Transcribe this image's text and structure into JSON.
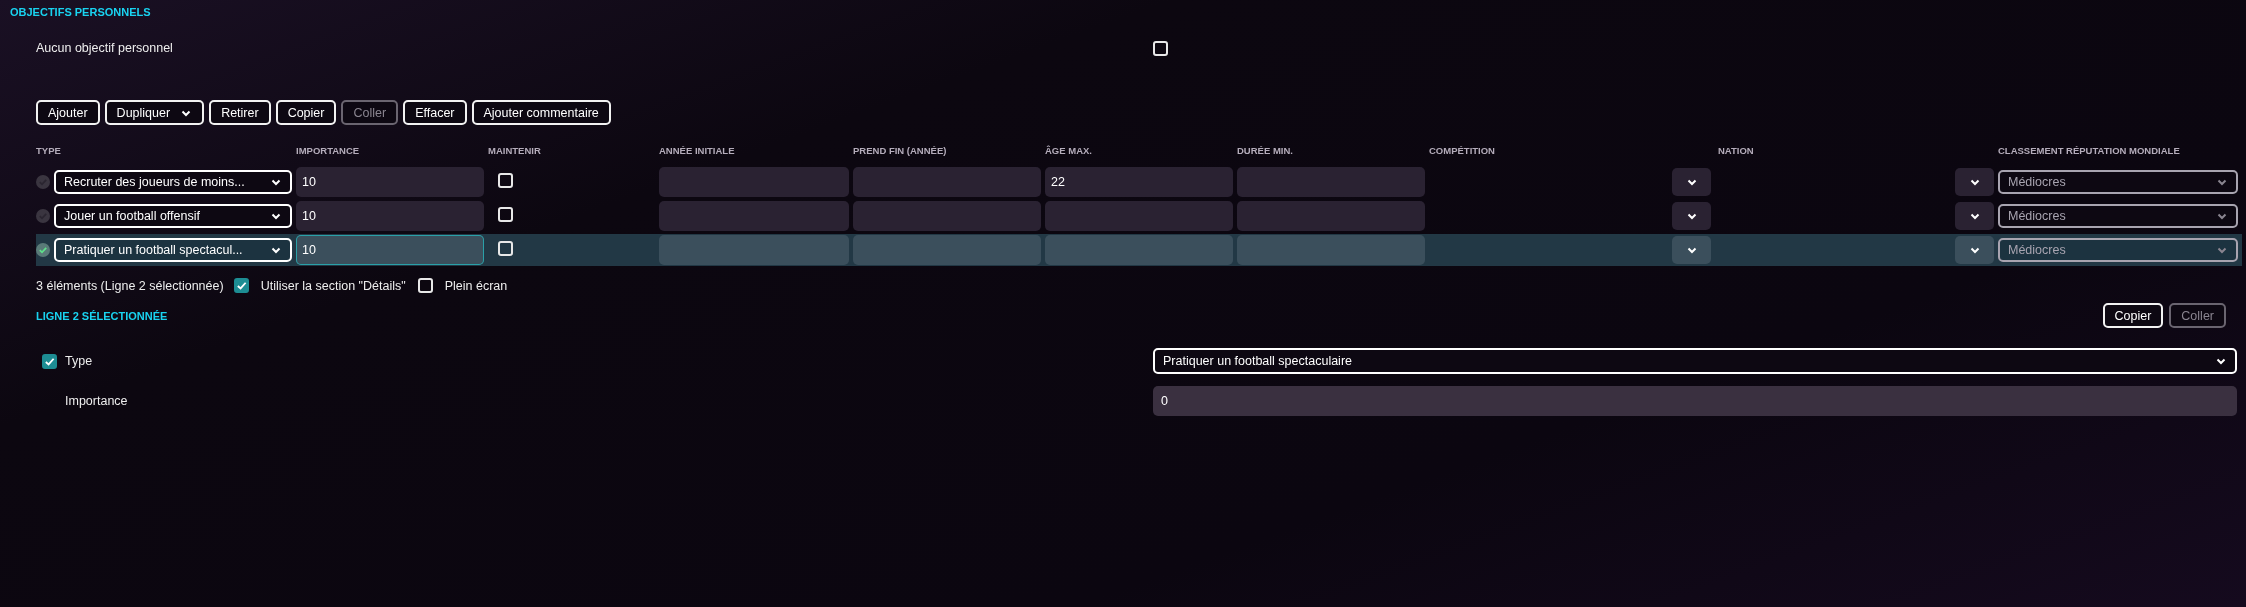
{
  "section_title": "OBJECTIFS PERSONNELS",
  "empty_option": {
    "label": "Aucun objectif personnel",
    "checked": false
  },
  "toolbar": [
    {
      "label": "Ajouter",
      "disabled": false,
      "dropdown": false
    },
    {
      "label": "Dupliquer",
      "disabled": false,
      "dropdown": true
    },
    {
      "label": "Retirer",
      "disabled": false,
      "dropdown": false
    },
    {
      "label": "Copier",
      "disabled": false,
      "dropdown": false
    },
    {
      "label": "Coller",
      "disabled": true,
      "dropdown": false
    },
    {
      "label": "Effacer",
      "disabled": false,
      "dropdown": false
    },
    {
      "label": "Ajouter commentaire",
      "disabled": false,
      "dropdown": false
    }
  ],
  "columns": [
    "TYPE",
    "IMPORTANCE",
    "MAINTENIR",
    "ANNÉE INITIALE",
    "PREND FIN (ANNÉE)",
    "ÂGE MAX.",
    "DURÉE MIN.",
    "COMPÉTITION",
    "NATION",
    "CLASSEMENT RÉPUTATION MONDIALE"
  ],
  "rows": [
    {
      "selected": false,
      "achieved": false,
      "type": "Recruter des joueurs de moins...",
      "importance": "10",
      "maintain": false,
      "max_age": "22",
      "reputation": "Médiocres"
    },
    {
      "selected": false,
      "achieved": false,
      "type": "Jouer un football offensif",
      "importance": "10",
      "maintain": false,
      "reputation": "Médiocres"
    },
    {
      "selected": true,
      "achieved": true,
      "type": "Pratiquer un football spectacul...",
      "importance": "10",
      "maintain": false,
      "reputation": "Médiocres"
    }
  ],
  "footer": {
    "count": "3 éléments (Ligne 2 sélectionnée)",
    "options": [
      {
        "label": "Utiliser la section \"Détails\"",
        "checked": true
      },
      {
        "label": "Plein écran",
        "checked": false
      }
    ]
  },
  "details": {
    "title": "LIGNE 2 SÉLECTIONNÉE",
    "buttons": [
      {
        "label": "Copier",
        "disabled": false
      },
      {
        "label": "Coller",
        "disabled": true
      }
    ],
    "fields": [
      {
        "kind": "select",
        "label": "Type",
        "checked": true,
        "value": "Pratiquer un football spectaculaire"
      },
      {
        "kind": "input",
        "label": "Importance",
        "value": "0"
      }
    ]
  }
}
